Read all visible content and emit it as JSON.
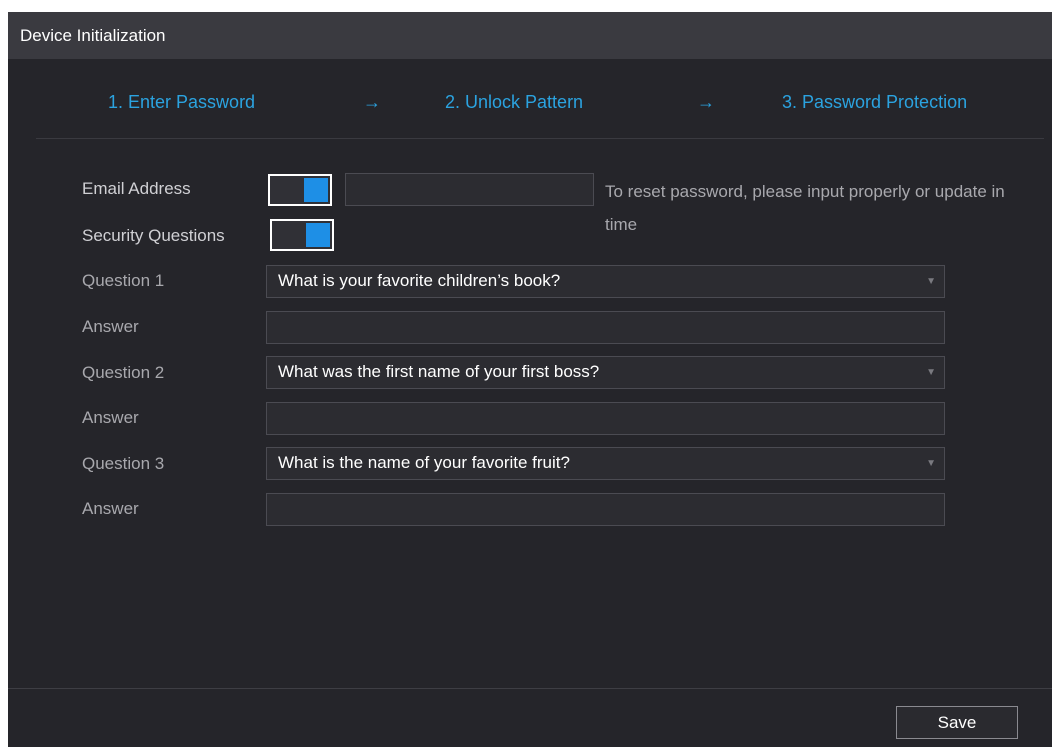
{
  "window": {
    "title": "Device Initialization"
  },
  "steps": [
    {
      "label": "1.  Enter Password"
    },
    {
      "label": "2.  Unlock Pattern"
    },
    {
      "label": "3.  Password Protection"
    }
  ],
  "step_arrow": "→",
  "email": {
    "label": "Email Address",
    "enabled": true,
    "value": ""
  },
  "security_questions": {
    "label": "Security Questions",
    "enabled": true
  },
  "hint": "To reset password, please input properly or update in time",
  "questions": [
    {
      "label": "Question 1",
      "selected": "What is your favorite children’s book?",
      "answer_label": "Answer",
      "answer": ""
    },
    {
      "label": "Question 2",
      "selected": "What was the first name of your first boss?",
      "answer_label": "Answer",
      "answer": ""
    },
    {
      "label": "Question 3",
      "selected": "What is the name of your favorite fruit?",
      "answer_label": "Answer",
      "answer": ""
    }
  ],
  "save_label": "Save",
  "colors": {
    "accent": "#2ba3e0",
    "toggle_on": "#1e8fe6",
    "background": "#25252a",
    "titlebar": "#3a3a40"
  },
  "icons": {
    "dropdown": "caret-down-icon",
    "arrow": "arrow-right-icon"
  }
}
